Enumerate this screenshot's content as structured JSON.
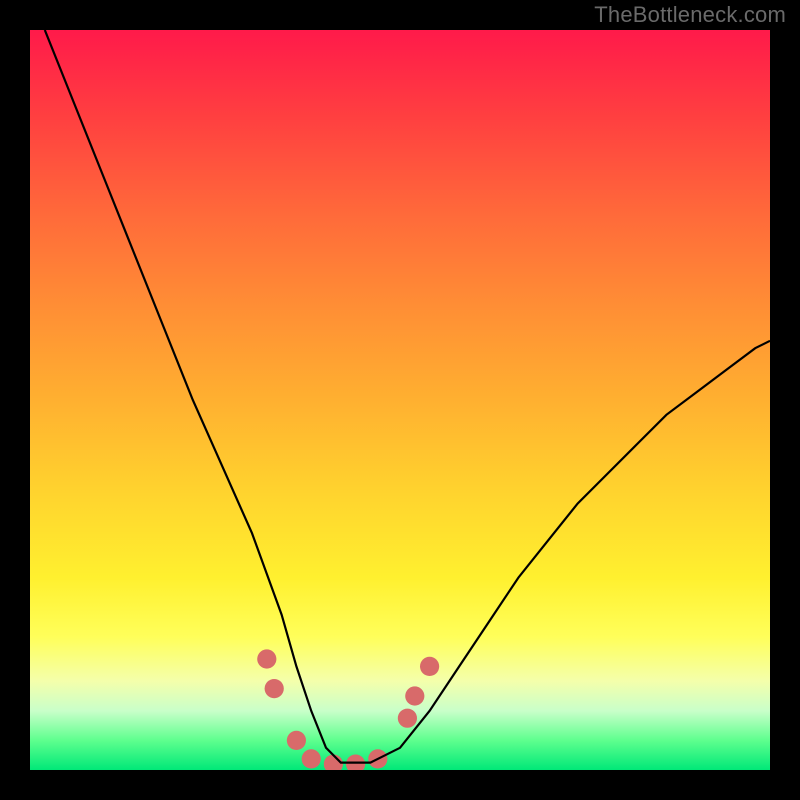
{
  "watermark": {
    "text": "TheBottleneck.com"
  },
  "chart_data": {
    "type": "line",
    "title": "",
    "xlabel": "",
    "ylabel": "",
    "xlim": [
      0,
      100
    ],
    "ylim": [
      0,
      100
    ],
    "grid": false,
    "series": [
      {
        "name": "curve",
        "color": "#000000",
        "x": [
          2,
          6,
          10,
          14,
          18,
          22,
          26,
          30,
          34,
          36,
          38,
          40,
          42,
          46,
          50,
          54,
          58,
          62,
          66,
          70,
          74,
          78,
          82,
          86,
          90,
          94,
          98,
          100
        ],
        "y": [
          100,
          90,
          80,
          70,
          60,
          50,
          41,
          32,
          21,
          14,
          8,
          3,
          1,
          1,
          3,
          8,
          14,
          20,
          26,
          31,
          36,
          40,
          44,
          48,
          51,
          54,
          57,
          58
        ]
      }
    ],
    "markers": {
      "name": "highlight-points",
      "color": "#d86a6a",
      "radius_pct": 1.3,
      "points": [
        {
          "x": 32,
          "y": 15
        },
        {
          "x": 33,
          "y": 11
        },
        {
          "x": 36,
          "y": 4
        },
        {
          "x": 38,
          "y": 1.5
        },
        {
          "x": 41,
          "y": 0.8
        },
        {
          "x": 44,
          "y": 0.8
        },
        {
          "x": 47,
          "y": 1.5
        },
        {
          "x": 51,
          "y": 7
        },
        {
          "x": 52,
          "y": 10
        },
        {
          "x": 54,
          "y": 14
        }
      ]
    }
  }
}
